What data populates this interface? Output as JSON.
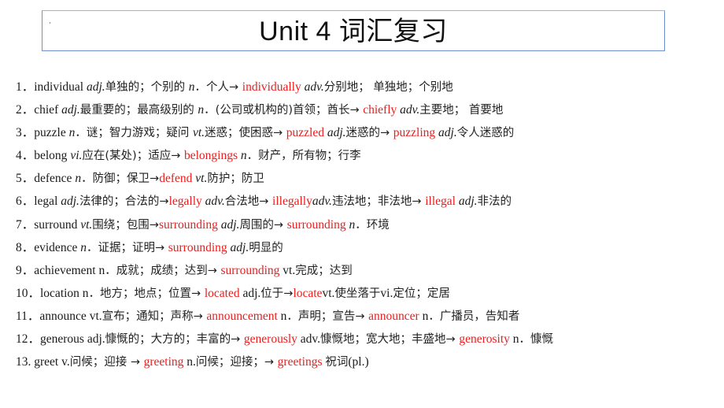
{
  "title": {
    "text": "Unit 4  词汇复习"
  },
  "colors": {
    "text": "#1a1a1a",
    "highlight": "#ee1c1c",
    "title_border": "#6f8fcf"
  },
  "entries": [
    {
      "segments": [
        {
          "t": "1．individual ",
          "s": "normal"
        },
        {
          "t": "adj.",
          "s": "italic"
        },
        {
          "t": "单独的；个别的 ",
          "s": "cjk"
        },
        {
          "t": "n",
          "s": "italic"
        },
        {
          "t": "．个人→ ",
          "s": "cjk"
        },
        {
          "t": "individually",
          "s": "red"
        },
        {
          "t": " ",
          "s": "normal"
        },
        {
          "t": "adv.",
          "s": "italic"
        },
        {
          "t": "分别地； 单独地；个别地",
          "s": "cjk"
        }
      ]
    },
    {
      "segments": [
        {
          "t": "2．chief ",
          "s": "normal"
        },
        {
          "t": "adj.",
          "s": "italic"
        },
        {
          "t": "最重要的；最高级别的 ",
          "s": "cjk"
        },
        {
          "t": "n",
          "s": "italic"
        },
        {
          "t": "．(公司或机构的)首领；酋长→ ",
          "s": "cjk"
        },
        {
          "t": "chiefly",
          "s": "red"
        },
        {
          "t": " ",
          "s": "normal"
        },
        {
          "t": "adv.",
          "s": "italic"
        },
        {
          "t": "主要地； 首要地",
          "s": "cjk"
        }
      ]
    },
    {
      "segments": [
        {
          "t": "3．puzzle ",
          "s": "normal"
        },
        {
          "t": "n",
          "s": "italic"
        },
        {
          "t": "．谜；智力游戏；疑问 ",
          "s": "cjk"
        },
        {
          "t": "vt.",
          "s": "italic"
        },
        {
          "t": "迷惑；使困惑→ ",
          "s": "cjk"
        },
        {
          "t": "puzzled",
          "s": "red"
        },
        {
          "t": " ",
          "s": "normal"
        },
        {
          "t": "adj.",
          "s": "italic"
        },
        {
          "t": "迷惑的→ ",
          "s": "cjk"
        },
        {
          "t": "puzzling",
          "s": "red"
        },
        {
          "t": " ",
          "s": "normal"
        },
        {
          "t": "adj.",
          "s": "italic"
        },
        {
          "t": "令人迷惑的",
          "s": "cjk"
        }
      ]
    },
    {
      "segments": [
        {
          "t": "4．belong ",
          "s": "normal"
        },
        {
          "t": "vi.",
          "s": "italic"
        },
        {
          "t": "应在(某处)；适应→ ",
          "s": "cjk"
        },
        {
          "t": "belongings",
          "s": "red"
        },
        {
          "t": " ",
          "s": "normal"
        },
        {
          "t": "n",
          "s": "italic"
        },
        {
          "t": "．财产，所有物；行李",
          "s": "cjk"
        }
      ]
    },
    {
      "segments": [
        {
          "t": "5．defence ",
          "s": "normal"
        },
        {
          "t": "n",
          "s": "italic"
        },
        {
          "t": "．防御；保卫→",
          "s": "cjk"
        },
        {
          "t": "defend",
          "s": "red"
        },
        {
          "t": " ",
          "s": "normal"
        },
        {
          "t": "vt.",
          "s": "italic"
        },
        {
          "t": "防护；防卫",
          "s": "cjk"
        }
      ]
    },
    {
      "segments": [
        {
          "t": "6．legal ",
          "s": "normal"
        },
        {
          "t": "adj.",
          "s": "italic"
        },
        {
          "t": "法律的；合法的→",
          "s": "cjk"
        },
        {
          "t": "legally",
          "s": "red"
        },
        {
          "t": " ",
          "s": "normal"
        },
        {
          "t": "adv.",
          "s": "italic"
        },
        {
          "t": "合法地→ ",
          "s": "cjk"
        },
        {
          "t": "illegally",
          "s": "red"
        },
        {
          "t": "adv.",
          "s": "italic"
        },
        {
          "t": "违法地；非法地→ ",
          "s": "cjk"
        },
        {
          "t": "illegal",
          "s": "red"
        },
        {
          "t": " ",
          "s": "normal"
        },
        {
          "t": "adj.",
          "s": "italic"
        },
        {
          "t": "非法的",
          "s": "cjk"
        }
      ]
    },
    {
      "segments": [
        {
          "t": "7．surround ",
          "s": "normal"
        },
        {
          "t": "vt.",
          "s": "italic"
        },
        {
          "t": "围绕；包围→",
          "s": "cjk"
        },
        {
          "t": "surrounding",
          "s": "red"
        },
        {
          "t": " ",
          "s": "normal"
        },
        {
          "t": "adj.",
          "s": "italic"
        },
        {
          "t": "周围的→ ",
          "s": "cjk"
        },
        {
          "t": "surrounding",
          "s": "red"
        },
        {
          "t": " ",
          "s": "normal"
        },
        {
          "t": "n",
          "s": "italic"
        },
        {
          "t": "．环境",
          "s": "cjk"
        }
      ]
    },
    {
      "segments": [
        {
          "t": "8．evidence ",
          "s": "normal"
        },
        {
          "t": "n",
          "s": "italic"
        },
        {
          "t": "．证据；证明→ ",
          "s": "cjk"
        },
        {
          "t": "surrounding",
          "s": "red"
        },
        {
          "t": " ",
          "s": "normal"
        },
        {
          "t": "adj.",
          "s": "italic"
        },
        {
          "t": "明显的",
          "s": "cjk"
        }
      ]
    },
    {
      "segments": [
        {
          "t": "9．achievement n",
          "s": "normal"
        },
        {
          "t": "．成就；成绩；达到→ ",
          "s": "cjk"
        },
        {
          "t": "surrounding",
          "s": "red"
        },
        {
          "t": " vt.",
          "s": "normal"
        },
        {
          "t": "完成；达到",
          "s": "cjk"
        }
      ]
    },
    {
      "segments": [
        {
          "t": "10．location n",
          "s": "normal"
        },
        {
          "t": "．地方；地点；位置→ ",
          "s": "cjk"
        },
        {
          "t": "located",
          "s": "red"
        },
        {
          "t": " adj.",
          "s": "normal"
        },
        {
          "t": "位于→",
          "s": "cjk"
        },
        {
          "t": "locate",
          "s": "red"
        },
        {
          "t": "vt.",
          "s": "normal"
        },
        {
          "t": "使坐落于",
          "s": "cjk"
        },
        {
          "t": "vi.",
          "s": "normal"
        },
        {
          "t": "定位；定居",
          "s": "cjk"
        }
      ]
    },
    {
      "segments": [
        {
          "t": "11．announce vt.",
          "s": "normal"
        },
        {
          "t": "宣布；通知；声称→  ",
          "s": "cjk"
        },
        {
          "t": "announcement",
          "s": "red"
        },
        {
          "t": " n",
          "s": "normal"
        },
        {
          "t": "．声明；宣告→ ",
          "s": "cjk"
        },
        {
          "t": "announcer",
          "s": "red"
        },
        {
          "t": "  n",
          "s": "normal"
        },
        {
          "t": "．广播员，告知者",
          "s": "cjk"
        }
      ]
    },
    {
      "segments": [
        {
          "t": "12．generous adj.",
          "s": "normal"
        },
        {
          "t": "慷慨的；大方的；丰富的→ ",
          "s": "cjk"
        },
        {
          "t": "generously",
          "s": "red"
        },
        {
          "t": "  adv.",
          "s": "normal"
        },
        {
          "t": "慷慨地；宽大地；丰盛地→ ",
          "s": "cjk"
        },
        {
          "t": "generosity",
          "s": "red"
        },
        {
          "t": " n",
          "s": "normal"
        },
        {
          "t": "．慷慨",
          "s": "cjk"
        }
      ]
    },
    {
      "segments": [
        {
          "t": "13.  greet  v.",
          "s": "normal"
        },
        {
          "t": "问候；迎接 →  ",
          "s": "cjk"
        },
        {
          "t": "greeting",
          "s": "red"
        },
        {
          "t": "   n.",
          "s": "normal"
        },
        {
          "t": "问候；迎接；→  ",
          "s": "cjk"
        },
        {
          "t": "greetings",
          "s": "red"
        },
        {
          "t": "  ",
          "s": "normal"
        },
        {
          "t": "祝词",
          "s": "cjk"
        },
        {
          "t": "(pl.)",
          "s": "normal"
        }
      ]
    }
  ]
}
